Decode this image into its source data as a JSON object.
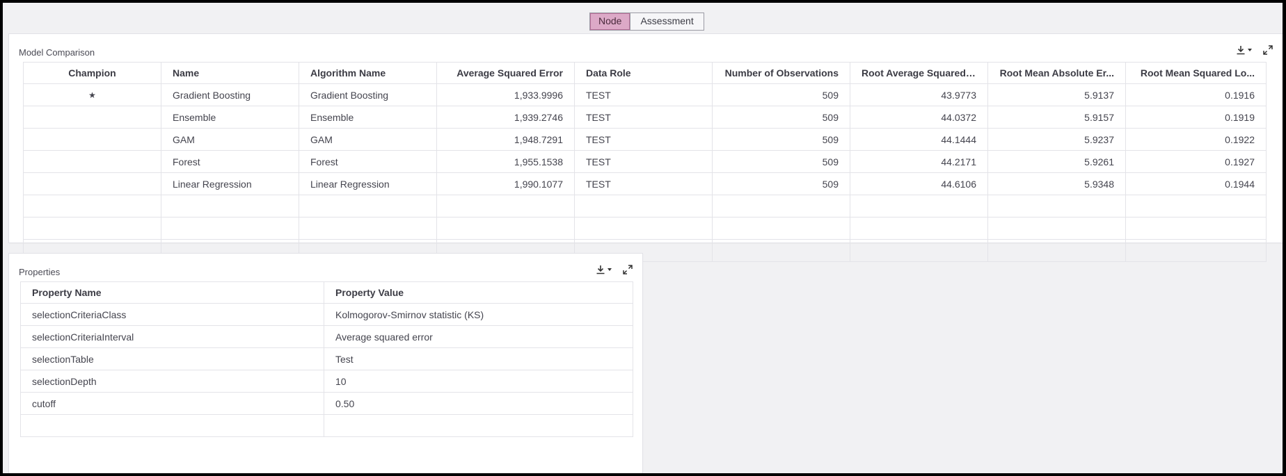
{
  "toggle": {
    "node_label": "Node",
    "assessment_label": "Assessment",
    "active": "Node"
  },
  "model_comparison": {
    "title": "Model Comparison",
    "columns": [
      "Champion",
      "Name",
      "Algorithm Name",
      "Average Squared Error",
      "Data Role",
      "Number of Observations",
      "Root Average Squared ...",
      "Root Mean Absolute Er...",
      "Root Mean Squared Lo..."
    ],
    "rows": [
      [
        "★",
        "Gradient Boosting",
        "Gradient Boosting",
        "1,933.9996",
        "TEST",
        "509",
        "43.9773",
        "5.9137",
        "0.1916"
      ],
      [
        "",
        "Ensemble",
        "Ensemble",
        "1,939.2746",
        "TEST",
        "509",
        "44.0372",
        "5.9157",
        "0.1919"
      ],
      [
        "",
        "GAM",
        "GAM",
        "1,948.7291",
        "TEST",
        "509",
        "44.1444",
        "5.9237",
        "0.1922"
      ],
      [
        "",
        "Forest",
        "Forest",
        "1,955.1538",
        "TEST",
        "509",
        "44.2171",
        "5.9261",
        "0.1927"
      ],
      [
        "",
        "Linear Regression",
        "Linear Regression",
        "1,990.1077",
        "TEST",
        "509",
        "44.6106",
        "5.9348",
        "0.1944"
      ]
    ],
    "empty_rows": 3
  },
  "properties": {
    "title": "Properties",
    "columns": [
      "Property Name",
      "Property Value"
    ],
    "rows": [
      [
        "selectionCriteriaClass",
        "Kolmogorov-Smirnov statistic (KS)"
      ],
      [
        "selectionCriteriaInterval",
        "Average squared error"
      ],
      [
        "selectionTable",
        "Test"
      ],
      [
        "selectionDepth",
        "10"
      ],
      [
        "cutoff",
        "0.50"
      ]
    ]
  },
  "icons": {
    "download": "download-icon",
    "dropdown": "caret-down-icon",
    "maximize": "expand-icon"
  },
  "colors": {
    "toggle_active_bg": "#dca9c7",
    "background": "#f1f1f3",
    "panel": "#ffffff"
  }
}
